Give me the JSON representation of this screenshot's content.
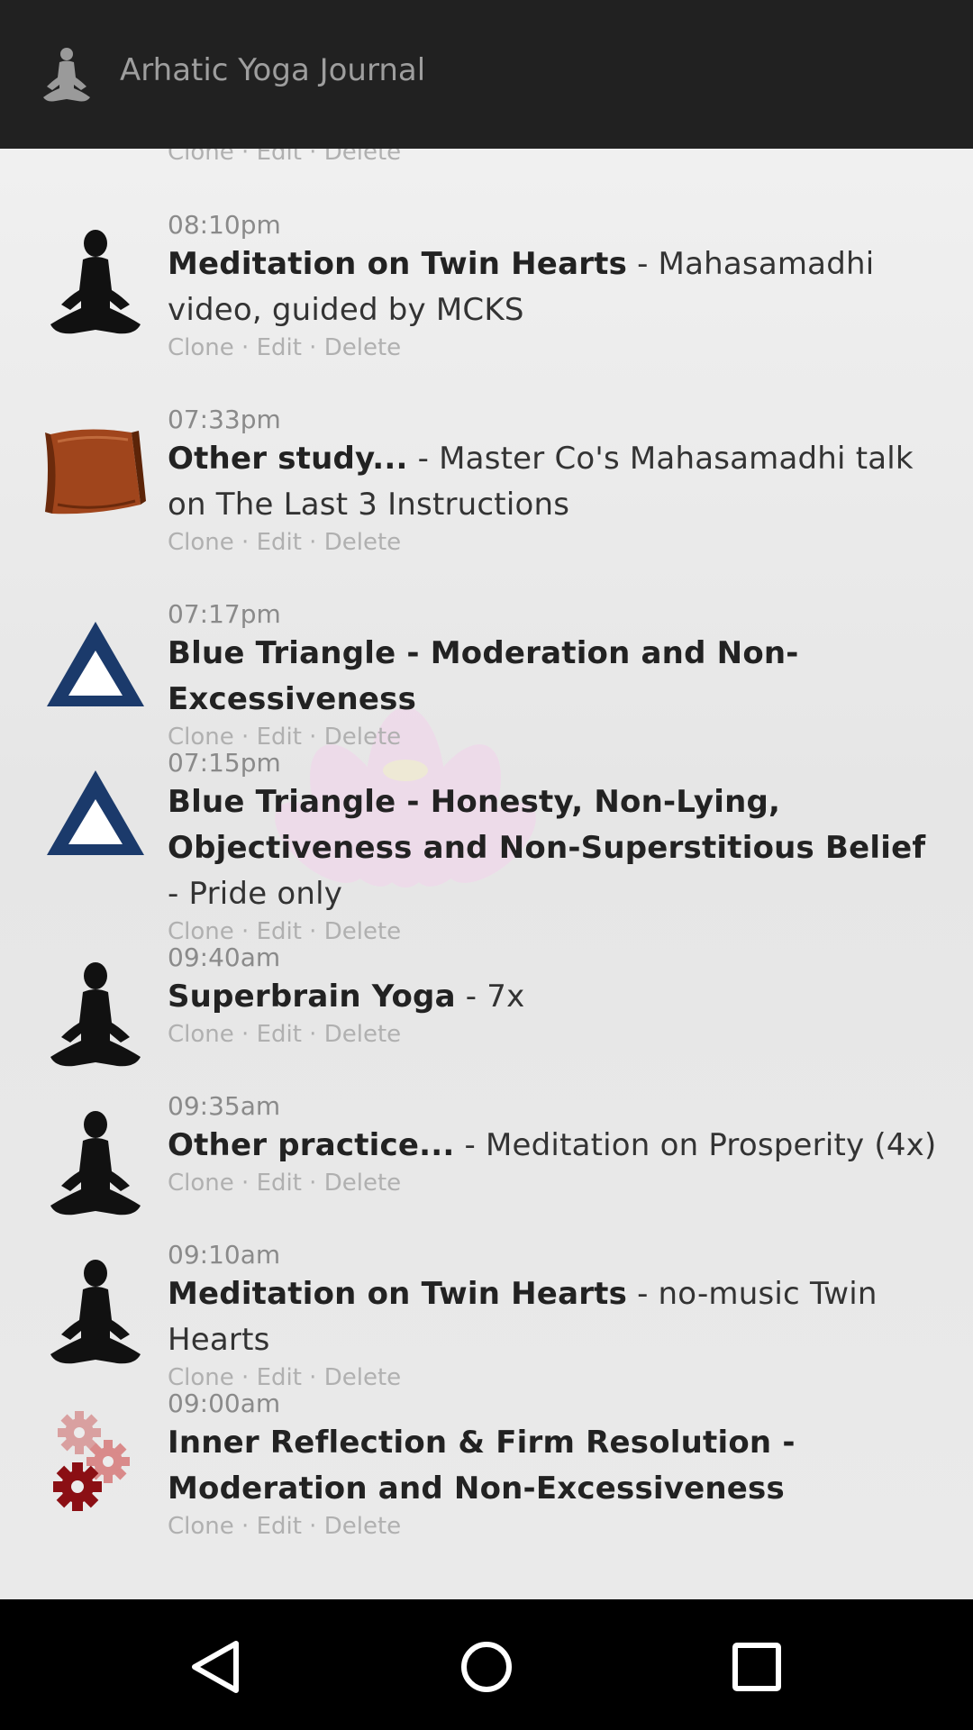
{
  "appbar": {
    "title": "Arhatic Yoga Journal",
    "icon": "meditation-icon"
  },
  "top_partial_actions": {
    "clone": "Clone",
    "sep1": " · ",
    "edit": "Edit",
    "sep2": " · ",
    "delete": "Delete"
  },
  "entries": [
    {
      "time": "08:10pm",
      "title": "Meditation on Twin Hearts",
      "detail": " - Mahasamadhi video, guided by MCKS",
      "icon": "meditation-figure-icon",
      "clone": "Clone",
      "sep1": " · ",
      "edit": "Edit",
      "sep2": " · ",
      "delete": "Delete"
    },
    {
      "time": "07:33pm",
      "title": "Other study...",
      "detail": " - Master Co's Mahasamadhi talk on The Last 3 Instructions",
      "icon": "book-icon",
      "clone": "Clone",
      "sep1": " · ",
      "edit": "Edit",
      "sep2": " · ",
      "delete": "Delete"
    },
    {
      "time": "07:17pm",
      "title": "Blue Triangle - Moderation and Non-Excessiveness",
      "detail": "",
      "icon": "blue-triangle-icon",
      "clone": "Clone",
      "sep1": " · ",
      "edit": "Edit",
      "sep2": " · ",
      "delete": "Delete"
    },
    {
      "time": "07:15pm",
      "title": "Blue Triangle - Honesty, Non-Lying, Objectiveness and Non-Superstitious Belief",
      "detail": " - Pride only",
      "icon": "blue-triangle-icon",
      "clone": "Clone",
      "sep1": " · ",
      "edit": "Edit",
      "sep2": " · ",
      "delete": "Delete"
    },
    {
      "time": "09:40am",
      "title": "Superbrain Yoga",
      "detail": " - 7x",
      "icon": "meditation-figure-icon",
      "clone": "Clone",
      "sep1": " · ",
      "edit": "Edit",
      "sep2": " · ",
      "delete": "Delete"
    },
    {
      "time": "09:35am",
      "title": "Other practice...",
      "detail": " - Meditation on Prosperity (4x)",
      "icon": "meditation-figure-icon",
      "clone": "Clone",
      "sep1": " · ",
      "edit": "Edit",
      "sep2": " · ",
      "delete": "Delete"
    },
    {
      "time": "09:10am",
      "title": "Meditation on Twin Hearts",
      "detail": " - no-music Twin Hearts",
      "icon": "meditation-figure-icon",
      "clone": "Clone",
      "sep1": " · ",
      "edit": "Edit",
      "sep2": " · ",
      "delete": "Delete"
    },
    {
      "time": "09:00am",
      "title": "Inner Reflection & Firm Resolution - Moderation and Non-Excessiveness",
      "detail": "",
      "icon": "gears-icon",
      "clone": "Clone",
      "sep1": " · ",
      "edit": "Edit",
      "sep2": " · ",
      "delete": "Delete"
    }
  ],
  "colors": {
    "appbar": "#212121",
    "triangle": "#1b3a6b",
    "gear_dark": "#8b0f14",
    "gear_light": "#d9a0a0",
    "book": "#a0451c"
  },
  "navbar": {
    "back": "back-icon",
    "home": "home-icon",
    "recents": "recents-icon"
  }
}
